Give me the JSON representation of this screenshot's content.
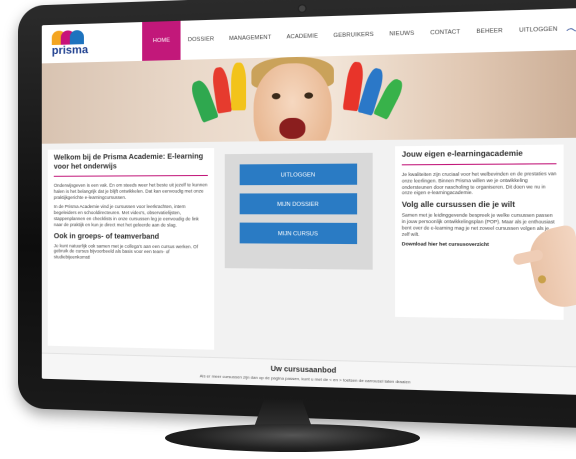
{
  "brand": {
    "logo_text": "prisma"
  },
  "nav": {
    "items": [
      "HOME",
      "DOSSIER",
      "MANAGEMENT",
      "ACADEMIE",
      "GEBRUIKERS",
      "NIEUWS",
      "CONTACT",
      "BEHEER",
      "UITLOGGEN"
    ],
    "active": "HOME"
  },
  "left": {
    "title": "Welkom bij de Prisma Academie: E-learning voor het onderwijs",
    "p1": "Onderwijsgeven is een vak. En om steeds weer het beste uit jezelf te kunnen halen is het belangrijk dat je blijft ontwikkelen. Dat kan eenvoudig met onze praktijkgerichte e-learningcursussen.",
    "p2": "In de Prisma Academie vind je cursussen voor leerkrachten, intern begeleiders en schooldirecteuren. Met video's, observatielijsten, stappenplannen en checklists in onze cursussen leg je eenvoudig de link naar de praktijk en kun je direct met het geleerde aan de slag.",
    "heading2": "Ook in groeps- of teamverband",
    "p3": "Je kunt natuurlijk ook samen met je collega's aan een cursus werken. Of gebruik de cursus bijvoorbeeld als basis voor een team- of studiebijeenkomst!"
  },
  "buttons": {
    "logout": "UITLOGGEN",
    "dossier": "MIJN DOSSIER",
    "course": "MIJN CURSUS"
  },
  "right": {
    "title": "Jouw eigen e-learningacademie",
    "p1": "Je kwaliteiten zijn cruciaal voor het welbevinden en de prestaties van onze leerlingen. Binnen Prisma willen we je ontwikkeling ondersteunen door nascholing te organiseren. Dit doen we nu in onze eigen e-learningacademie.",
    "heading2": "Volg alle cursussen die je wilt",
    "p2": "Samen met je leidinggevende bespreek je welke cursussen passen in jouw persoonlijk ontwikkelingsplan (POP). Maar als je enthousiast bent over de e-learning mag je net zoveel cursussen volgen als je zelf wilt.",
    "link": "Download hier het cursusoverzicht"
  },
  "offer": {
    "title": "Uw cursusaanbod",
    "subtitle": "Als er meer cursussen zijn dan op de pagina passen, kunt u met de < en > toetsen de carrousel laten draaien"
  }
}
